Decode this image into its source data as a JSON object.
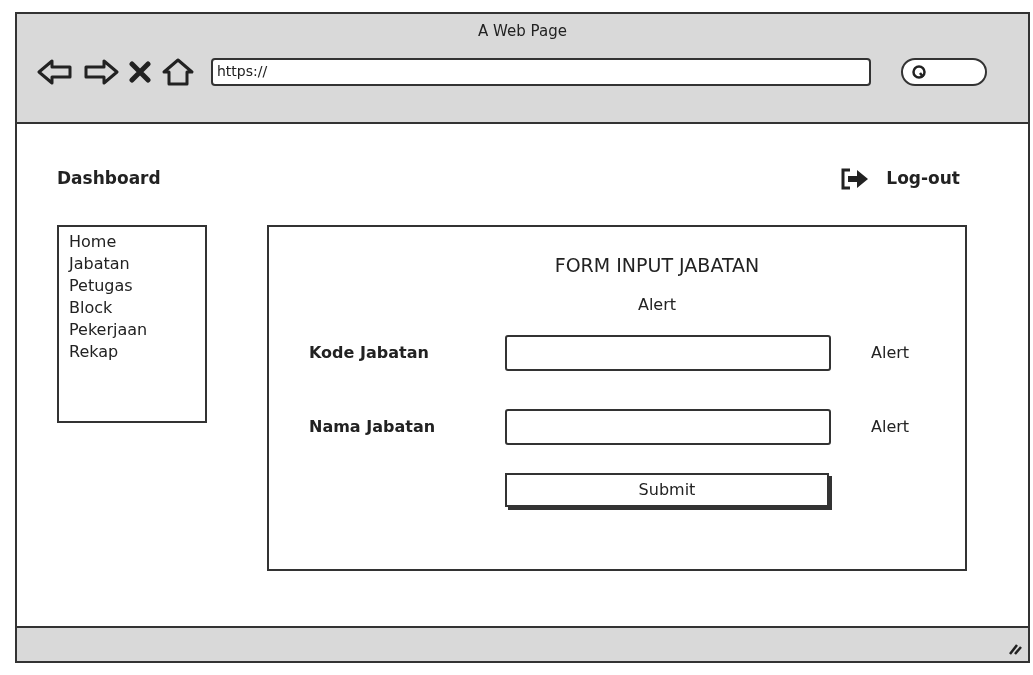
{
  "window": {
    "title": "A Web Page"
  },
  "address_bar": {
    "value": "https://"
  },
  "header": {
    "title": "Dashboard",
    "logout": "Log-out"
  },
  "sidebar": {
    "items": [
      {
        "label": "Home"
      },
      {
        "label": "Jabatan"
      },
      {
        "label": "Petugas"
      },
      {
        "label": "Block"
      },
      {
        "label": "Pekerjaan"
      },
      {
        "label": "Rekap"
      }
    ]
  },
  "form": {
    "title": "FORM INPUT JABATAN",
    "alert": "Alert",
    "fields": [
      {
        "label": "Kode Jabatan",
        "alert": "Alert"
      },
      {
        "label": "Nama Jabatan",
        "alert": "Alert"
      }
    ],
    "submit": "Submit"
  }
}
